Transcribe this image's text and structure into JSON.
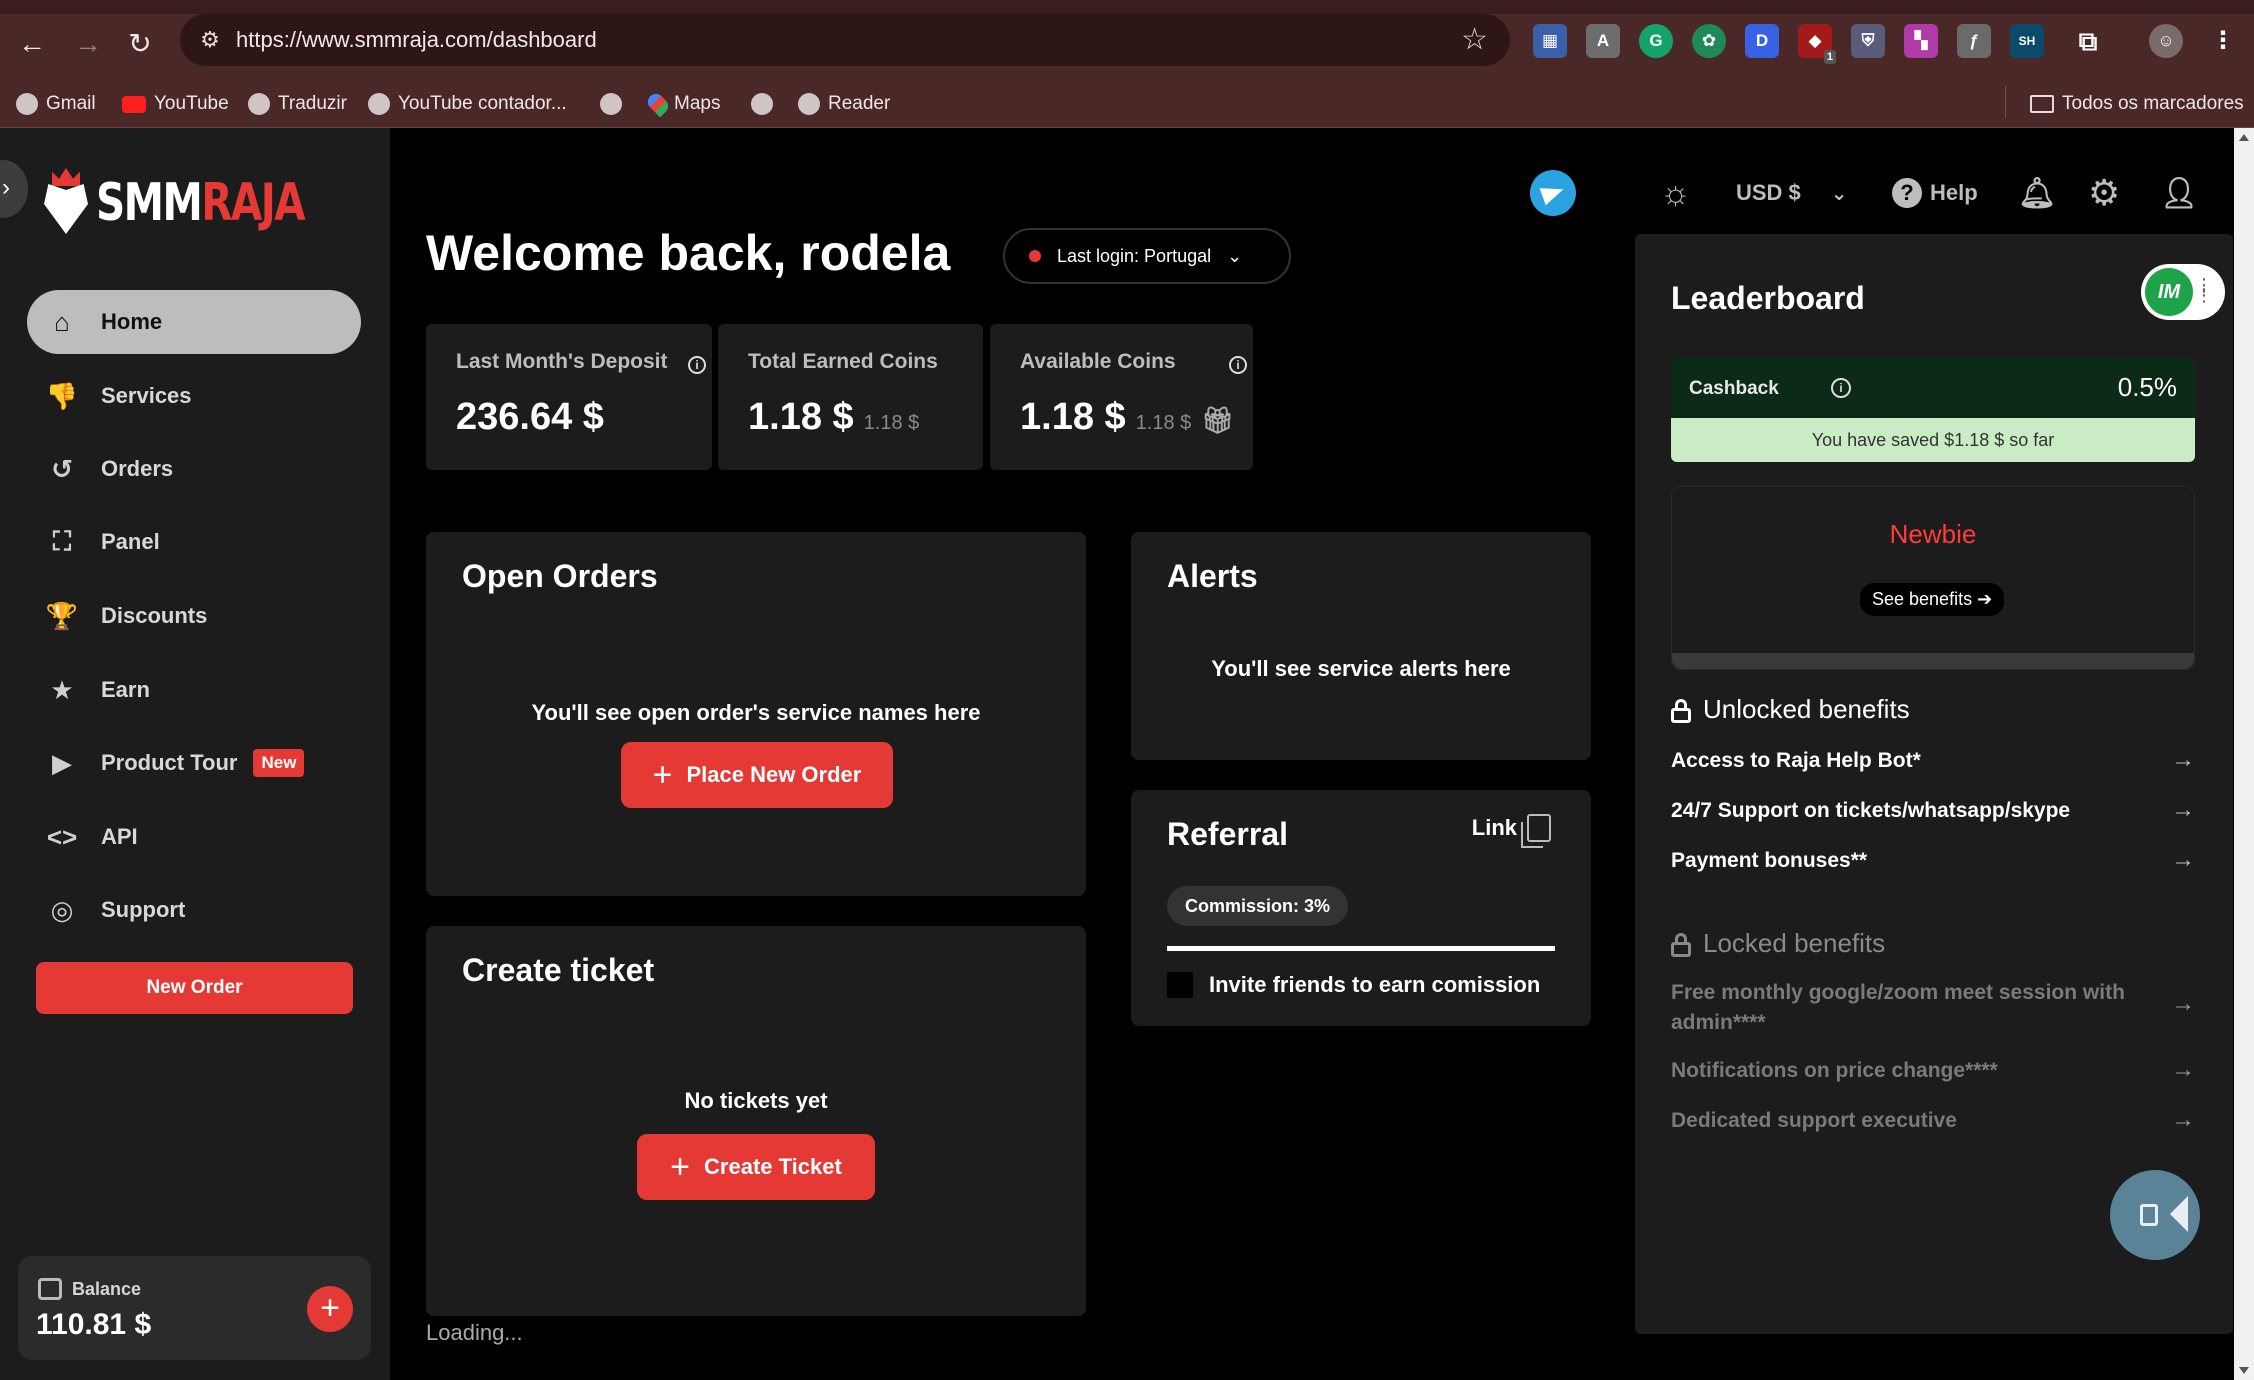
{
  "browser": {
    "url": "https://www.smmraja.com/dashboard",
    "bookmarks": [
      "Gmail",
      "YouTube",
      "Traduzir",
      "YouTube contador...",
      "Maps",
      "Reader"
    ],
    "all_bookmarks": "Todos os marcadores",
    "extensions": [
      "calculator-ext",
      "translate-ext",
      "grammarly-ext",
      "chatgpt-ext",
      "d-ext",
      "ublock-ext",
      "shield-ext",
      "colorpick-ext",
      "font-ext",
      "sh-ext",
      "puzzle-ext",
      "profile-avatar"
    ],
    "ext_badge": "1"
  },
  "sidebar": {
    "logo_smm": "SMM",
    "logo_raja": "RAJA",
    "items": [
      {
        "label": "Home",
        "icon": "home-icon"
      },
      {
        "label": "Services",
        "icon": "services-icon"
      },
      {
        "label": "Orders",
        "icon": "history-icon"
      },
      {
        "label": "Panel",
        "icon": "panel-icon"
      },
      {
        "label": "Discounts",
        "icon": "trophy-icon"
      },
      {
        "label": "Earn",
        "icon": "star-icon"
      },
      {
        "label": "Product Tour",
        "icon": "play-icon",
        "badge": "New"
      },
      {
        "label": "API",
        "icon": "code-icon"
      },
      {
        "label": "Support",
        "icon": "lifebuoy-icon"
      }
    ],
    "new_order": "New Order",
    "balance_label": "Balance",
    "balance_value": "110.81 $"
  },
  "header": {
    "currency": "USD $",
    "help": "Help"
  },
  "main": {
    "welcome": "Welcome back, rodela",
    "last_login": "Last login: Portugal",
    "stats": [
      {
        "label": "Last Month's Deposit",
        "value": "236.64 $",
        "sub": ""
      },
      {
        "label": "Total Earned Coins",
        "value": "1.18 $",
        "sub": "1.18 $"
      },
      {
        "label": "Available Coins",
        "value": "1.18 $",
        "sub": "1.18 $"
      }
    ],
    "open_orders": {
      "title": "Open Orders",
      "message": "You'll see open order's service names here",
      "button": "Place New Order"
    },
    "alerts": {
      "title": "Alerts",
      "message": "You'll see service alerts here"
    },
    "referral": {
      "title": "Referral",
      "link": "Link",
      "commission": "Commission: 3%",
      "invite": "Invite friends to earn comission"
    },
    "ticket": {
      "title": "Create ticket",
      "message": "No tickets yet",
      "button": "Create Ticket"
    },
    "loading": "Loading..."
  },
  "leaderboard": {
    "title": "Leaderboard",
    "toggle_logo": "IM",
    "cashback_label": "Cashback",
    "cashback_value": "0.5%",
    "saved": "You have saved  $1.18 $ so far",
    "tier": "Newbie",
    "see_benefits": "See benefits ➔",
    "unlocked_title": "Unlocked benefits",
    "unlocked": [
      "Access to Raja Help Bot*",
      "24/7 Support on tickets/whatsapp/skype",
      "Payment bonuses**"
    ],
    "locked_title": "Locked benefits",
    "locked": [
      "Free monthly google/zoom meet session with admin****",
      "Notifications on price change****",
      "Dedicated support executive"
    ]
  },
  "colors": {
    "accent": "#e53935",
    "sidebar_bg": "#1c1c1c",
    "card_bg": "#1c1c1c",
    "cashback_bg": "#0c2a18",
    "saved_bg": "#c9ecc5"
  }
}
